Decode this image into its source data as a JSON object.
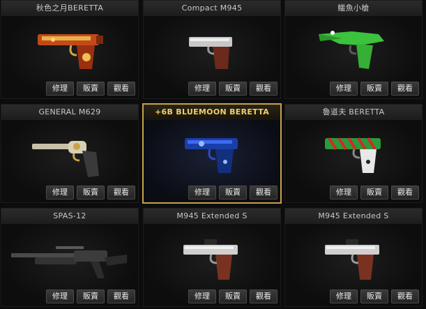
{
  "items": [
    {
      "name": "秋色之月BERETTA",
      "icon": "autumn-beretta-pistol-icon",
      "selected": false
    },
    {
      "name": "Compact M945",
      "icon": "compact-m945-pistol-icon",
      "selected": false
    },
    {
      "name": "鱷魚小槍",
      "icon": "crocodile-pistol-icon",
      "selected": false
    },
    {
      "name": "GENERAL M629",
      "icon": "general-m629-revolver-icon",
      "selected": false
    },
    {
      "name": "+6B BLUEMOON BERETTA",
      "icon": "bluemoon-beretta-pistol-icon",
      "selected": true
    },
    {
      "name": "魯道夫 BERETTA",
      "icon": "rudolph-beretta-pistol-icon",
      "selected": false
    },
    {
      "name": "SPAS-12",
      "icon": "spas12-shotgun-icon",
      "selected": false
    },
    {
      "name": "M945 Extended S",
      "icon": "m945-extended-pistol-icon",
      "selected": false
    },
    {
      "name": "M945 Extended S",
      "icon": "m945-extended-pistol-icon",
      "selected": false
    }
  ],
  "buttons": {
    "repair": "修理",
    "sell": "販賣",
    "view": "觀看"
  },
  "colors": {
    "selected_border": "#c8a24a",
    "selected_title": "#f2cf68",
    "button_bg": "#2e2e2e"
  }
}
